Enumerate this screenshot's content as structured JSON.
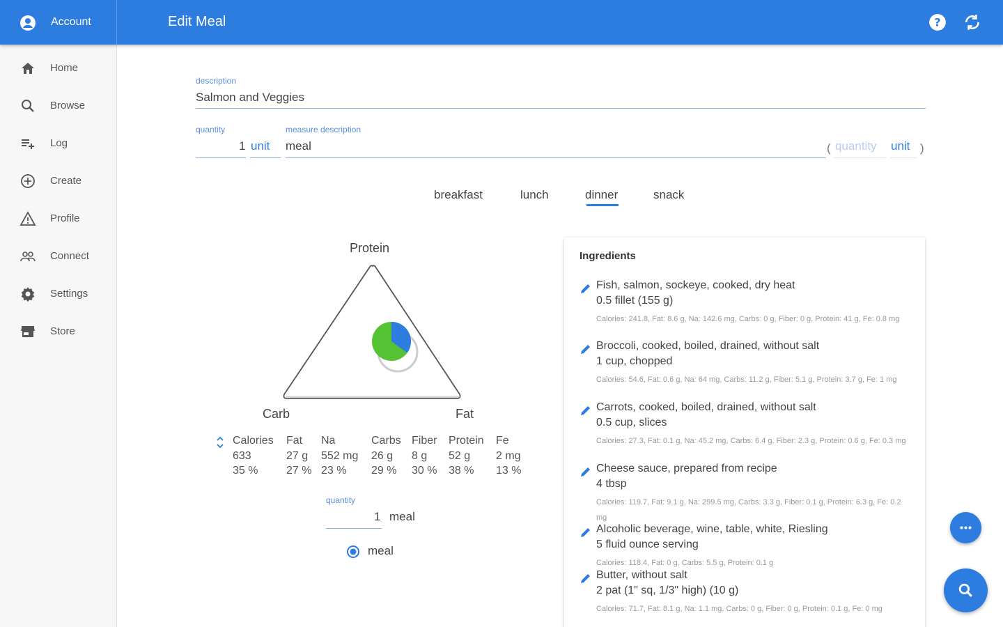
{
  "header": {
    "account_label": "Account",
    "title": "Edit Meal",
    "help_icon": "help-circle-icon",
    "sync_icon": "sync-icon"
  },
  "sidebar": {
    "items": [
      {
        "label": "Home",
        "icon": "home-icon"
      },
      {
        "label": "Browse",
        "icon": "search-icon"
      },
      {
        "label": "Log",
        "icon": "playlist-add-icon"
      },
      {
        "label": "Create",
        "icon": "add-circle-icon"
      },
      {
        "label": "Profile",
        "icon": "warning-triangle-icon"
      },
      {
        "label": "Connect",
        "icon": "people-icon"
      },
      {
        "label": "Settings",
        "icon": "gear-icon"
      },
      {
        "label": "Store",
        "icon": "store-icon"
      }
    ]
  },
  "form": {
    "description_label": "description",
    "description_value": "Salmon and Veggies",
    "quantity_label": "quantity",
    "quantity_value": "1",
    "unit_label": "unit",
    "measure_label": "measure description",
    "measure_value": "meal",
    "alt_quantity_placeholder": "quantity",
    "alt_unit_label": "unit"
  },
  "tabs": [
    {
      "label": "breakfast",
      "selected": false
    },
    {
      "label": "lunch",
      "selected": false
    },
    {
      "label": "dinner",
      "selected": true
    },
    {
      "label": "snack",
      "selected": false
    }
  ],
  "triangle": {
    "top_label": "Protein",
    "left_label": "Carb",
    "right_label": "Fat",
    "pie_protein_fraction": 0.35,
    "colors": {
      "carb": "#54c232",
      "protein": "#2d7ce0",
      "fat": "#9e9e9e"
    }
  },
  "nutrition": {
    "headers": [
      "Calories",
      "Fat",
      "Na",
      "Carbs",
      "Fiber",
      "Protein",
      "Fe"
    ],
    "amounts": [
      "633",
      "27 g",
      "552 mg",
      "26 g",
      "8 g",
      "52 g",
      "2 mg"
    ],
    "percents": [
      "35 %",
      "27 %",
      "23 %",
      "29 %",
      "30 %",
      "38 %",
      "13 %"
    ]
  },
  "serving": {
    "quantity_label": "quantity",
    "quantity_value": "1",
    "unit_value": "meal",
    "radio_label": "meal"
  },
  "ingredients": {
    "title": "Ingredients",
    "items": [
      {
        "name": "Fish, salmon, sockeye, cooked, dry heat",
        "measure": "0.5 fillet (155 g)",
        "detail": "Calories: 241.8, Fat: 8.6 g, Na: 142.6 mg, Carbs: 0 g, Fiber: 0 g, Protein: 41 g, Fe: 0.8 mg"
      },
      {
        "name": "Broccoli, cooked, boiled, drained, without salt",
        "measure": "1 cup, chopped",
        "detail": "Calories: 54.6, Fat: 0.6 g, Na: 64 mg, Carbs: 11.2 g, Fiber: 5.1 g, Protein: 3.7 g, Fe: 1 mg"
      },
      {
        "name": "Carrots, cooked, boiled, drained, without salt",
        "measure": "0.5 cup, slices",
        "detail": "Calories: 27.3, Fat: 0.1 g, Na: 45.2 mg, Carbs: 6.4 g, Fiber: 2.3 g, Protein: 0.6 g, Fe: 0.3 mg"
      },
      {
        "name": "Cheese sauce, prepared from recipe",
        "measure": "4 tbsp",
        "detail": "Calories: 119.7, Fat: 9.1 g, Na: 299.5 mg, Carbs: 3.3 g, Fiber: 0.1 g, Protein: 6.3 g, Fe: 0.2 mg"
      },
      {
        "name": "Alcoholic beverage, wine, table, white, Riesling",
        "measure": "5 fluid ounce serving",
        "detail": "Calories: 118.4, Fat: 0 g, Carbs: 5.5 g, Protein: 0.1 g"
      },
      {
        "name": "Butter, without salt",
        "measure": "2 pat (1\" sq, 1/3\" high) (10 g)",
        "detail": "Calories: 71.7, Fat: 8.1 g, Na: 1.1 mg, Carbs: 0 g, Fiber: 0 g, Protein: 0.1 g, Fe: 0 mg"
      }
    ]
  },
  "fabs": {
    "more_icon": "more-horizontal-icon",
    "search_icon": "search-icon"
  },
  "colors": {
    "primary": "#2d7ce0",
    "accent_green": "#54c232"
  }
}
